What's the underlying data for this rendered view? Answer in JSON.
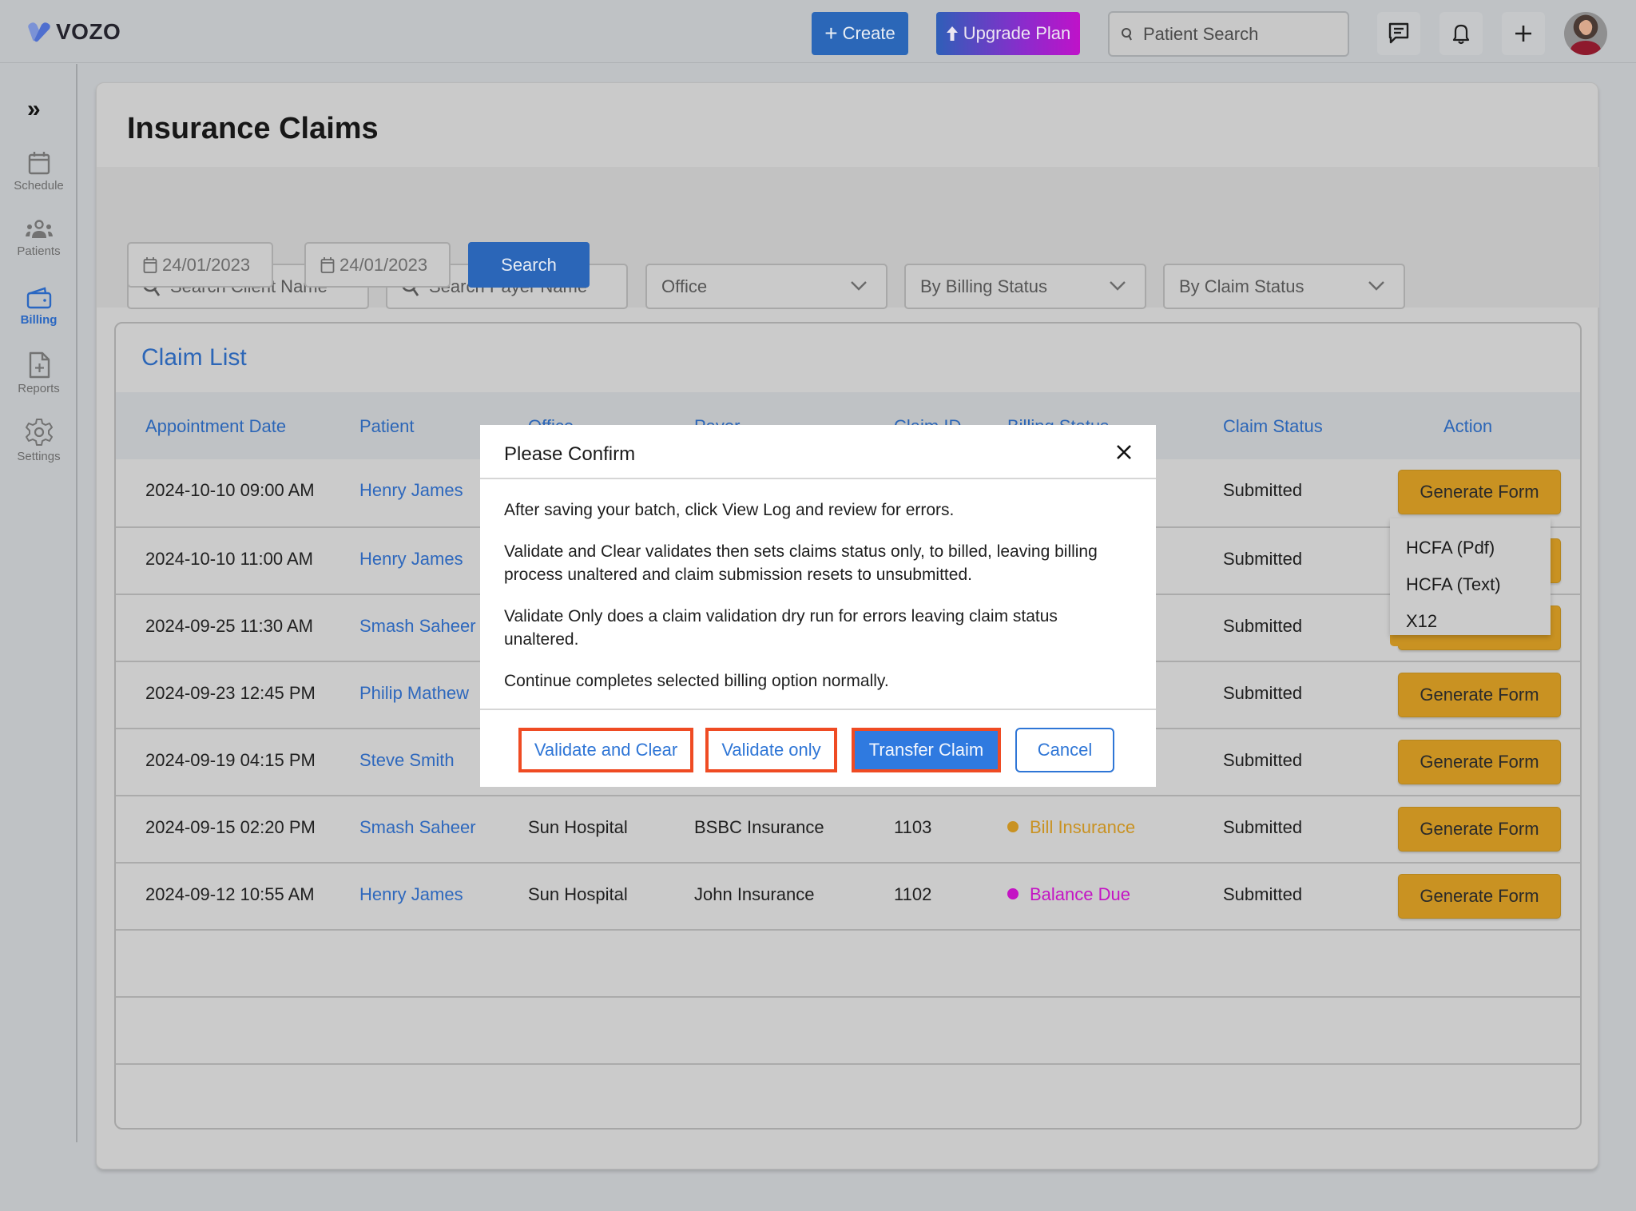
{
  "app": {
    "brand": "VOZO",
    "brand_color": "#4f72cf"
  },
  "topbar": {
    "create_label": "Create",
    "upgrade_label": "Upgrade Plan",
    "patient_search_placeholder": "Patient Search",
    "icons": [
      "message-icon",
      "bell-icon",
      "plus-icon"
    ],
    "avatar_alt": "User avatar"
  },
  "sidebar": {
    "expand_icon": "double-chevron-right-icon",
    "items": [
      {
        "label": "Schedule",
        "icon": "calendar-icon",
        "active": false
      },
      {
        "label": "Patients",
        "icon": "users-icon",
        "active": false
      },
      {
        "label": "Billing",
        "icon": "wallet-icon",
        "active": true
      },
      {
        "label": "Reports",
        "icon": "file-plus-icon",
        "active": false
      },
      {
        "label": "Settings",
        "icon": "gear-icon",
        "active": false
      }
    ]
  },
  "page": {
    "title": "Insurance Claims"
  },
  "filters": {
    "client_search_placeholder": "Search Client Name",
    "payer_search_placeholder": "Search Payer Name",
    "office_select": "Office",
    "billing_status_select": "By Billing Status",
    "claim_status_select": "By Claim Status",
    "date_from": "24/01/2023",
    "date_to": "24/01/2023",
    "search_label": "Search"
  },
  "claim_list": {
    "title": "Claim List",
    "columns": [
      "Appointment Date",
      "Patient",
      "Office",
      "Payer",
      "Claim ID",
      "Billing Status",
      "Claim Status",
      "Action"
    ],
    "rows": [
      {
        "date": "2024-10-10 09:00 AM",
        "patient": "Henry James",
        "office": "",
        "payer": "",
        "claim_id": "",
        "billing_status": "",
        "billing_color": "",
        "claim_status": "Submitted",
        "action": "Generate Form"
      },
      {
        "date": "2024-10-10 11:00 AM",
        "patient": "Henry James",
        "office": "",
        "payer": "",
        "claim_id": "",
        "billing_status": "",
        "billing_color": "",
        "claim_status": "Submitted",
        "action": "Generate Form"
      },
      {
        "date": "2024-09-25 11:30 AM",
        "patient": "Smash Saheer",
        "office": "",
        "payer": "",
        "claim_id": "",
        "billing_status": "",
        "billing_color": "",
        "claim_status": "Submitted",
        "action": "Generate Form"
      },
      {
        "date": "2024-09-23 12:45 PM",
        "patient": "Philip Mathew",
        "office": "",
        "payer": "",
        "claim_id": "",
        "billing_status": "",
        "billing_color": "",
        "claim_status": "Submitted",
        "action": "Generate Form"
      },
      {
        "date": "2024-09-19 04:15 PM",
        "patient": "Steve Smith",
        "office": "",
        "payer": "",
        "claim_id": "",
        "billing_status": "",
        "billing_color": "",
        "claim_status": "Submitted",
        "action": "Generate Form"
      },
      {
        "date": "2024-09-15 02:20 PM",
        "patient": "Smash Saheer",
        "office": "Sun Hospital",
        "payer": "BSBC Insurance",
        "claim_id": "1103",
        "billing_status": "Bill Insurance",
        "billing_color": "#c99222",
        "claim_status": "Submitted",
        "action": "Generate Form"
      },
      {
        "date": "2024-09-12 10:55 AM",
        "patient": "Henry James",
        "office": "Sun Hospital",
        "payer": "John Insurance",
        "claim_id": "1102",
        "billing_status": "Balance Due",
        "billing_color": "#c414c4",
        "claim_status": "Submitted",
        "action": "Generate Form"
      }
    ]
  },
  "generate_form_menu": {
    "items": [
      "HCFA (Pdf)",
      "HCFA (Text)",
      "X12"
    ]
  },
  "modal": {
    "title": "Please Confirm",
    "paragraphs": [
      "After saving your batch, click View Log and review for errors.",
      "Validate and Clear validates then sets claims status only, to billed, leaving billing process unaltered and claim submission resets to unsubmitted.",
      "Validate Only does a claim validation dry run for errors leaving claim status unaltered.",
      "Continue completes selected billing option normally."
    ],
    "buttons": {
      "validate_clear": "Validate and Clear",
      "validate_only": "Validate only",
      "transfer": "Transfer Claim",
      "cancel": "Cancel"
    }
  }
}
